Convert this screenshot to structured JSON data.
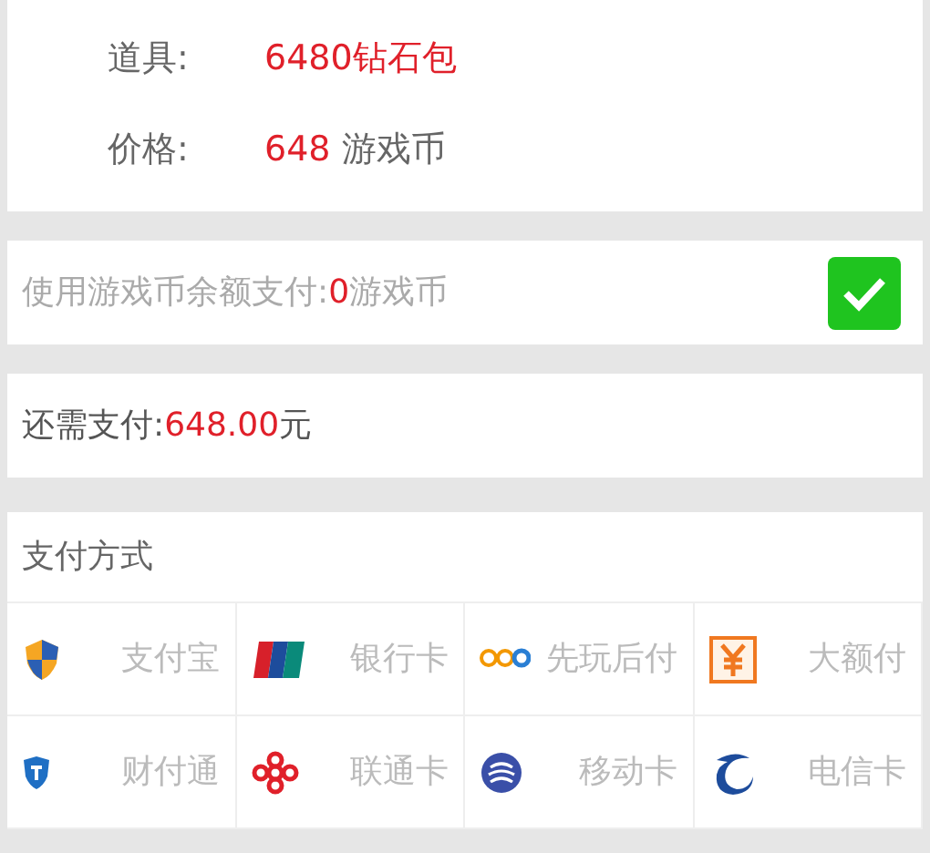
{
  "order": {
    "item_label": "道具:",
    "item_value": "6480钻石包",
    "price_label": "价格:",
    "price_amount": "648",
    "price_unit": "游戏币"
  },
  "balance": {
    "label": "使用游戏币余额支付:",
    "amount": "0",
    "unit": "游戏币",
    "checked": true
  },
  "due": {
    "label": "还需支付:",
    "amount": "648.00",
    "unit": "元"
  },
  "payment": {
    "title": "支付方式",
    "methods": [
      {
        "kind": "shield",
        "label": "支付宝"
      },
      {
        "kind": "card",
        "label": "银行卡"
      },
      {
        "kind": "dots",
        "label": "先玩后付"
      },
      {
        "kind": "yen",
        "label": "大额付"
      },
      {
        "kind": "tshield",
        "label": "财付通"
      },
      {
        "kind": "knot",
        "label": "联通卡"
      },
      {
        "kind": "globe",
        "label": "移动卡"
      },
      {
        "kind": "swirl",
        "label": "电信卡"
      }
    ]
  }
}
